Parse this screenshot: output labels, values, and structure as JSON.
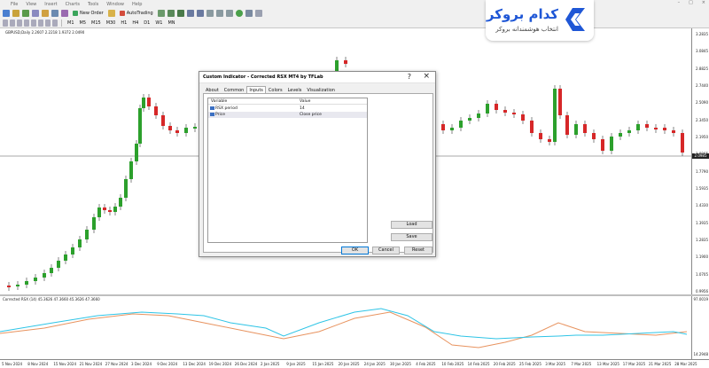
{
  "menu": {
    "items": [
      "File",
      "View",
      "Insert",
      "Charts",
      "Tools",
      "Window",
      "Help"
    ],
    "controls": [
      "–",
      "□",
      "×"
    ]
  },
  "toolbar": {
    "new_order": "New Order",
    "autotrading": "AutoTrading"
  },
  "timeframes": [
    "M1",
    "M5",
    "M15",
    "M30",
    "H1",
    "H4",
    "D1",
    "W1",
    "MN"
  ],
  "chart": {
    "header": "GBPUSD,Daily  2.2607 2.2218 1.9372 2.0490",
    "price_labels": [
      "3.2835",
      "3.0845",
      "2.8825",
      "2.7440",
      "2.5090",
      "2.3450",
      "2.1950",
      "1.8965",
      "1.7790",
      "1.5935",
      "1.4330",
      "1.3935",
      "1.2835",
      "1.1900",
      "1.0705",
      "0.9956"
    ],
    "current_price": "2.0985",
    "time_labels": [
      "5 Nov 2024",
      "8 Nov 2024",
      "15 Nov 2024",
      "21 Nov 2024",
      "27 Nov 2024",
      "3 Dec 2024",
      "9 Dec 2024",
      "13 Dec 2024",
      "19 Dec 2024",
      "26 Dec 2024",
      "2 Jan 2025",
      "9 Jan 2025",
      "15 Jan 2025",
      "20 Jan 2025",
      "24 Jan 2025",
      "30 Jan 2025",
      "4 Feb 2025",
      "10 Feb 2025",
      "14 Feb 2025",
      "20 Feb 2025",
      "25 Feb 2025",
      "3 Mar 2025",
      "7 Mar 2025",
      "13 Mar 2025",
      "17 Mar 2025",
      "21 Mar 2025",
      "28 Mar 2025"
    ]
  },
  "indicator": {
    "header": "Corrected RSX (14) 45.3626 47.3660 45.3626 47.3660",
    "top_label": "97.0019",
    "bottom_label": "14.2948",
    "rsx_color": "#2ec4e6",
    "signal_color": "#e8935f"
  },
  "logo": {
    "title": "کدام بروکر",
    "subtitle": "انتخاب هوشمندانه بروکر",
    "brand_color": "#1f57d6"
  },
  "dialog": {
    "title": "Custom Indicator - Corrected RSX MT4 by TFLab",
    "help": "?",
    "close": "×",
    "tabs": [
      "About",
      "Common",
      "Inputs",
      "Colors",
      "Levels",
      "Visualization"
    ],
    "active_tab": "Inputs",
    "columns": {
      "variable": "Variable",
      "value": "Value"
    },
    "rows": [
      {
        "variable": "RSX period",
        "value": "14",
        "icon": "int-icon"
      },
      {
        "variable": "Price",
        "value": "Close price",
        "icon": "enum-icon"
      }
    ],
    "load": "Load",
    "save": "Save",
    "ok": "OK",
    "cancel": "Cancel",
    "reset": "Reset"
  }
}
